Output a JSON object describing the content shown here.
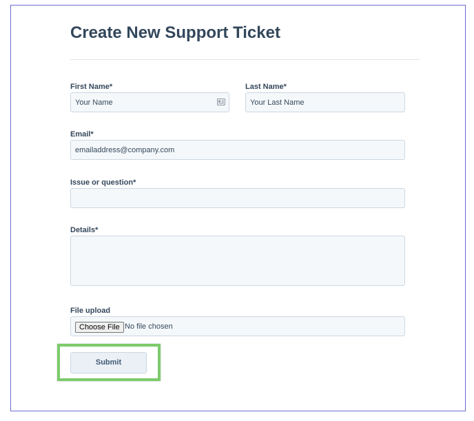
{
  "form": {
    "title": "Create New Support Ticket",
    "first_name": {
      "label": "First Name*",
      "value": "Your Name",
      "icon": "contact-card-icon"
    },
    "last_name": {
      "label": "Last Name*",
      "value": "Your Last Name"
    },
    "email": {
      "label": "Email*",
      "value": "emailaddress@company.com"
    },
    "issue": {
      "label": "Issue or question*",
      "value": ""
    },
    "details": {
      "label": "Details*",
      "value": ""
    },
    "file_upload": {
      "label": "File upload",
      "button_label": "Choose File",
      "status": "No file chosen"
    },
    "submit_label": "Submit"
  },
  "colors": {
    "highlight": "#7ccb6b",
    "frame_border": "#6b6bd6",
    "text": "#33475b"
  }
}
